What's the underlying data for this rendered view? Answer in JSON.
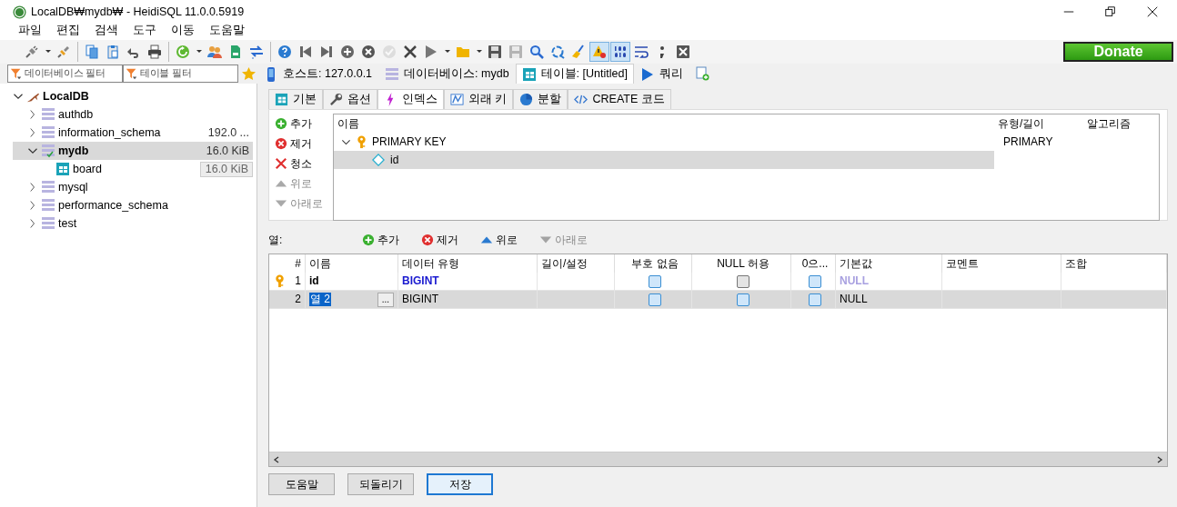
{
  "window": {
    "title": "LocalDB₩mydb₩ - HeidiSQL 11.0.0.5919"
  },
  "menu": [
    "파일",
    "편집",
    "검색",
    "도구",
    "이동",
    "도움말"
  ],
  "toolbar": [
    [
      {
        "kind": "plug",
        "pressed": false,
        "disabled": false
      },
      {
        "kind": "caret",
        "pressed": false,
        "disabled": false
      },
      {
        "kind": "plug2",
        "pressed": false,
        "disabled": false
      }
    ],
    [
      {
        "kind": "copy",
        "pressed": false,
        "disabled": false
      },
      {
        "kind": "paste",
        "pressed": false,
        "disabled": false
      },
      {
        "kind": "undo",
        "pressed": false,
        "disabled": false
      },
      {
        "kind": "print",
        "pressed": false,
        "disabled": false
      }
    ],
    [
      {
        "kind": "refresh",
        "pressed": false,
        "disabled": false
      },
      {
        "kind": "caret",
        "pressed": false,
        "disabled": false
      },
      {
        "kind": "users",
        "pressed": false,
        "disabled": false
      },
      {
        "kind": "file",
        "pressed": false,
        "disabled": false
      },
      {
        "kind": "transfer",
        "pressed": false,
        "disabled": false
      }
    ],
    [
      {
        "kind": "help",
        "pressed": false,
        "disabled": false
      },
      {
        "kind": "first",
        "pressed": false,
        "disabled": false
      },
      {
        "kind": "last",
        "pressed": false,
        "disabled": false
      },
      {
        "kind": "plus",
        "pressed": false,
        "disabled": false
      },
      {
        "kind": "remove",
        "pressed": false,
        "disabled": false
      },
      {
        "kind": "check",
        "pressed": false,
        "disabled": true
      },
      {
        "kind": "cancel",
        "pressed": false,
        "disabled": false
      },
      {
        "kind": "run",
        "pressed": false,
        "disabled": false
      },
      {
        "kind": "caret",
        "pressed": false,
        "disabled": false
      },
      {
        "kind": "folder",
        "pressed": false,
        "disabled": false
      },
      {
        "kind": "caret",
        "pressed": false,
        "disabled": false
      },
      {
        "kind": "save",
        "pressed": false,
        "disabled": false
      },
      {
        "kind": "save",
        "pressed": false,
        "disabled": true
      },
      {
        "kind": "search",
        "pressed": false,
        "disabled": false
      },
      {
        "kind": "replace",
        "pressed": false,
        "disabled": false
      },
      {
        "kind": "broom",
        "pressed": false,
        "disabled": false
      },
      {
        "kind": "warning",
        "pressed": true,
        "disabled": false
      },
      {
        "kind": "binary",
        "pressed": true,
        "disabled": false
      },
      {
        "kind": "wrap",
        "pressed": false,
        "disabled": false
      },
      {
        "kind": "semicolon",
        "pressed": false,
        "disabled": false
      },
      {
        "kind": "closebox",
        "pressed": false,
        "disabled": false
      }
    ]
  ],
  "donate_button": "Donate",
  "filters": [
    {
      "placeholder": "데이터베이스 필터"
    },
    {
      "placeholder": "테이블 필터"
    }
  ],
  "main_tabs": [
    {
      "label": "호스트: 127.0.0.1",
      "kind": "host",
      "selected": false
    },
    {
      "label": "데이터베이스: mydb",
      "kind": "database",
      "selected": false
    },
    {
      "label": "테이블: [Untitled]",
      "kind": "table",
      "selected": true
    },
    {
      "label": "쿼리",
      "kind": "query",
      "selected": false
    }
  ],
  "database_tree": [
    {
      "label": "LocalDB",
      "kind": "server",
      "expanded": true,
      "selected": false,
      "children": [
        {
          "label": "authdb",
          "kind": "database",
          "expanded": false,
          "selected": false,
          "active": false
        },
        {
          "label": "information_schema",
          "kind": "database",
          "expanded": false,
          "selected": false,
          "active": false,
          "size": "192.0 ..."
        },
        {
          "label": "mydb",
          "kind": "database",
          "expanded": true,
          "selected": true,
          "active": true,
          "size": "16.0 KiB",
          "children": [
            {
              "label": "board",
              "kind": "table",
              "selected": false,
              "size": "16.0 KiB"
            }
          ]
        },
        {
          "label": "mysql",
          "kind": "database",
          "expanded": false,
          "selected": false,
          "active": false
        },
        {
          "label": "performance_schema",
          "kind": "database",
          "expanded": false,
          "selected": false,
          "active": false
        },
        {
          "label": "test",
          "kind": "database",
          "expanded": false,
          "selected": false,
          "active": false
        }
      ]
    }
  ],
  "editor_tabs": [
    {
      "label": "기본",
      "kind": "basic",
      "selected": false
    },
    {
      "label": "옵션",
      "kind": "options",
      "selected": false
    },
    {
      "label": "인덱스",
      "kind": "indexes",
      "selected": true
    },
    {
      "label": "외래 키",
      "kind": "foreign",
      "selected": false
    },
    {
      "label": "분할",
      "kind": "partitions",
      "selected": false
    },
    {
      "label": "CREATE 코드",
      "kind": "code",
      "selected": false
    }
  ],
  "index_buttons": [
    {
      "label": "추가",
      "kind": "add",
      "disabled": false
    },
    {
      "label": "제거",
      "kind": "remove",
      "disabled": false
    },
    {
      "label": "청소",
      "kind": "clear",
      "disabled": false
    },
    {
      "label": "위로",
      "kind": "up",
      "disabled": true
    },
    {
      "label": "아래로",
      "kind": "down",
      "disabled": true
    }
  ],
  "index_columns": [
    "이름",
    "유형/길이",
    "알고리즘"
  ],
  "indexes": [
    {
      "name": "PRIMARY KEY",
      "type": "PRIMARY",
      "expanded": true,
      "selected": false,
      "children": [
        {
          "name": "id",
          "selected": true
        }
      ]
    }
  ],
  "columns_label": "열:",
  "column_buttons": [
    {
      "label": "추가",
      "kind": "add",
      "disabled": false
    },
    {
      "label": "제거",
      "kind": "remove",
      "disabled": false
    },
    {
      "label": "위로",
      "kind": "up",
      "disabled": false
    },
    {
      "label": "아래로",
      "kind": "down",
      "disabled": true
    }
  ],
  "grid_columns": [
    "#",
    "이름",
    "데이터 유형",
    "길이/설정",
    "부호 없음",
    "NULL 허용",
    "0으...",
    "기본값",
    "코멘트",
    "조합"
  ],
  "grid_rows": [
    {
      "number": "1",
      "name": "id",
      "primary_key": true,
      "selected": false,
      "editing": false,
      "type": "BIGINT",
      "unsigned": {
        "checked": false,
        "disabled": false
      },
      "allow_null": {
        "checked": false,
        "disabled": true
      },
      "zerofill": {
        "checked": false,
        "disabled": false
      },
      "default": "NULL",
      "default_greyed": true
    },
    {
      "number": "2",
      "name": "열 2",
      "primary_key": false,
      "selected": true,
      "editing": true,
      "edit_button": "...",
      "type": "BIGINT",
      "unsigned": {
        "checked": false,
        "disabled": false
      },
      "allow_null": {
        "checked": false,
        "disabled": false
      },
      "zerofill": {
        "checked": false,
        "disabled": false
      },
      "default": "NULL",
      "default_greyed": false
    }
  ],
  "buttons": [
    {
      "label": "도움말",
      "focused": false
    },
    {
      "label": "되돌리기",
      "focused": false
    },
    {
      "label": "저장",
      "focused": true
    }
  ]
}
